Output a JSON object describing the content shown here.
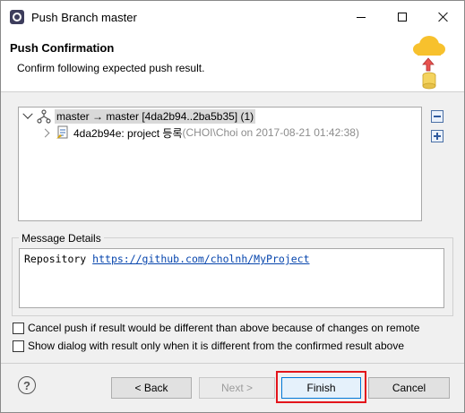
{
  "window": {
    "title": "Push Branch master"
  },
  "header": {
    "title": "Push Confirmation",
    "description": "Confirm following expected push result."
  },
  "tree": {
    "ref_row": {
      "label": "master → master [4da2b94..2ba5b35] (1)"
    },
    "commit_row": {
      "label": "4da2b94e: project 등록",
      "meta": " (CHOI\\Choi on 2017-08-21 01:42:38)"
    }
  },
  "message_details": {
    "legend": "Message Details",
    "prefix": "Repository ",
    "link": "https://github.com/cholnh/MyProject"
  },
  "options": {
    "cancel_push_label": "Cancel push if result would be different than above because of changes on remote",
    "show_dialog_label": "Show dialog with result only when it is different from the confirmed result above"
  },
  "footer": {
    "help": "?",
    "back_label": "< Back",
    "next_label": "Next >",
    "finish_label": "Finish",
    "cancel_label": "Cancel"
  },
  "colors": {
    "link": "#0645ad",
    "highlight": "#e3141b",
    "selection": "#d9d9d9"
  },
  "icons": {
    "app": "eclipse-icon",
    "header": "cloud-upload-icon",
    "ref": "branch-icon",
    "commit": "commit-icon"
  }
}
